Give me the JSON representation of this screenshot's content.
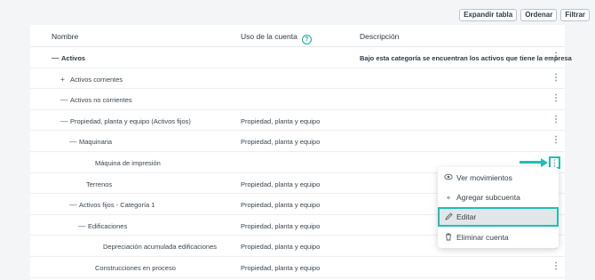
{
  "toolbar": {
    "expand": "Expandir tabla",
    "order": "Ordenar",
    "filter": "Filtrar"
  },
  "table": {
    "headers": {
      "name": "Nombre",
      "use": "Uso de la cuenta",
      "desc": "Descripción"
    },
    "rows": [
      {
        "expander": "—",
        "name": "Activos",
        "use": "",
        "desc": "Bajo esta categoría se encuentran los activos que tiene la empresa",
        "bold": true,
        "level": 0
      },
      {
        "expander": "+",
        "name": "Activos corrientes",
        "use": "",
        "desc": "",
        "level": 1
      },
      {
        "expander": "—",
        "name": "Activos no corrientes",
        "use": "",
        "desc": "",
        "level": 1
      },
      {
        "expander": "—",
        "name": "Propiedad, planta y equipo (Activos fijos)",
        "use": "Propiedad, planta y equipo",
        "desc": "",
        "level": 2
      },
      {
        "expander": "—",
        "name": "Maquinaria",
        "use": "Propiedad, planta y equipo",
        "desc": "",
        "level": 3
      },
      {
        "expander": "",
        "name": "Máquina de impresión",
        "use": "",
        "desc": "",
        "level": 4
      },
      {
        "expander": "",
        "name": "Terrenos",
        "use": "Propiedad, planta y equipo",
        "desc": "",
        "level": 3
      },
      {
        "expander": "—",
        "name": "Activos fijos - Categoría 1",
        "use": "Propiedad, planta y equipo",
        "desc": "",
        "level": 3
      },
      {
        "expander": "—",
        "name": "Edificaciones",
        "use": "Propiedad, planta y equipo",
        "desc": "",
        "level": 4
      },
      {
        "expander": "",
        "name": "Depreciación acumulada edificaciones",
        "use": "Propiedad, planta y equipo",
        "desc": "",
        "level": 5
      },
      {
        "expander": "",
        "name": "Construcciones en proceso",
        "use": "Propiedad, planta y equipo",
        "desc": "",
        "level": 4
      }
    ]
  },
  "context_menu": {
    "items": [
      {
        "icon": "eye-icon",
        "label": "Ver movimientos"
      },
      {
        "icon": "plus-icon",
        "label": "Agregar subcuenta"
      },
      {
        "icon": "pencil-icon",
        "label": "Editar",
        "active": true
      },
      {
        "icon": "trash-icon",
        "label": "Eliminar cuenta"
      }
    ]
  },
  "colors": {
    "accent": "#1ec0b4",
    "help": "#17a89f"
  }
}
